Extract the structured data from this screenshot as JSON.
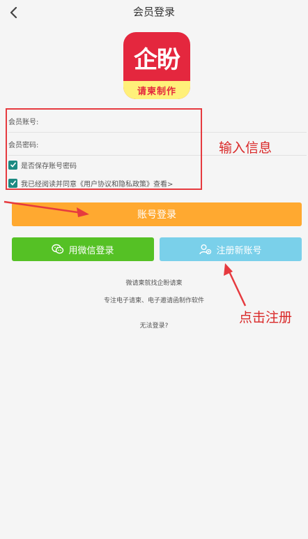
{
  "header": {
    "title": "会员登录"
  },
  "logo": {
    "mark": "企盼",
    "subtitle": "请柬制作"
  },
  "form": {
    "account_label": "会员账号:",
    "password_label": "会员密码:",
    "save_checkbox_label": "是否保存账号密码",
    "agree_checkbox_label": "我已经阅读并同意《用户协议和隐私政策》查看>"
  },
  "buttons": {
    "login_label": "账号登录",
    "wechat_label": "用微信登录",
    "register_label": "注册新账号"
  },
  "info": {
    "line1": "微请柬就找企盼请柬",
    "line2": "专注电子请柬、电子邀请函制作软件",
    "line3": "无法登录?"
  },
  "annotations": {
    "input_info": "输入信息",
    "click_register": "点击注册"
  },
  "colors": {
    "login_button": "#ffa930",
    "wechat_button": "#55c125",
    "register_button": "#7ad0ea",
    "checkbox": "#1d8a82",
    "annotation_red": "#e63a3f",
    "logo_red": "#e4273e",
    "logo_band": "#fff07a"
  },
  "icons": {
    "back": "chevron-left-icon",
    "checkbox": "checkmark-icon",
    "wechat": "wechat-icon",
    "register": "add-user-icon"
  }
}
